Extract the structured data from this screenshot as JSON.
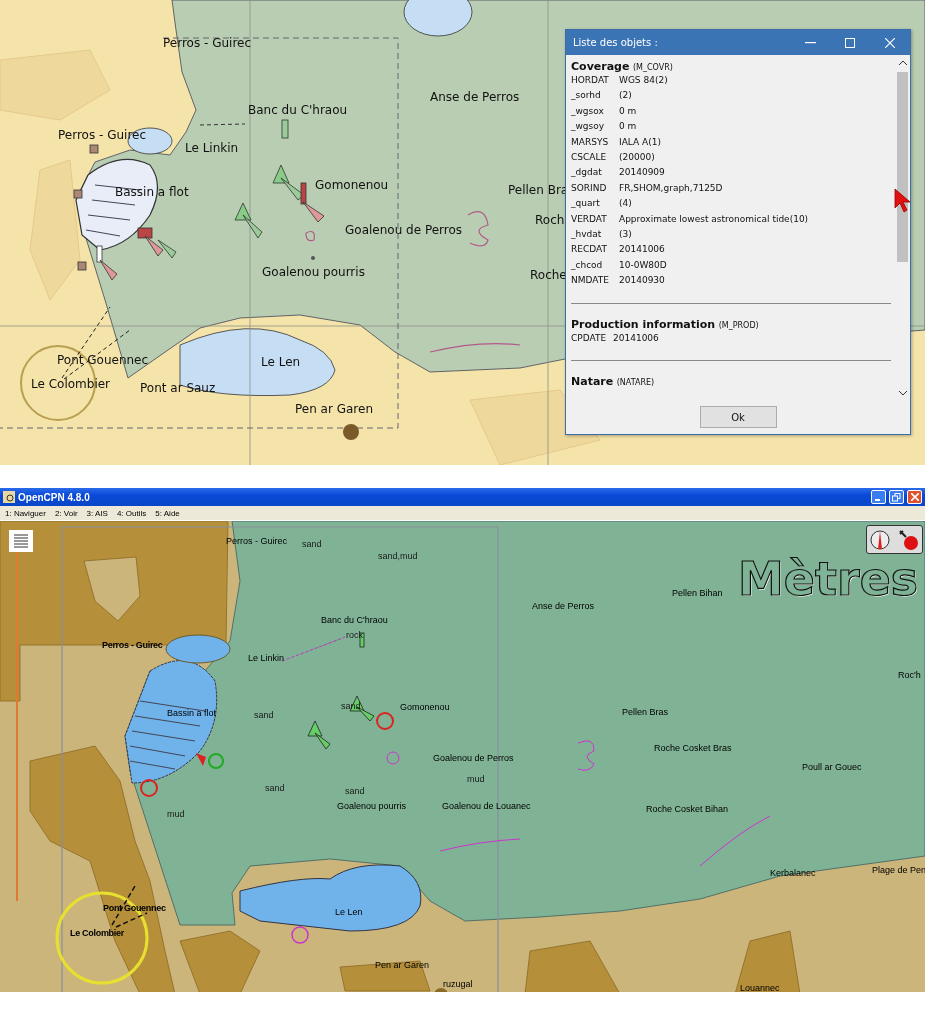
{
  "top_chart": {
    "labels": [
      {
        "text": "Perros - Guirec"
      },
      {
        "text": "Banc du C'hraou"
      },
      {
        "text": "Anse de Perros"
      },
      {
        "text": "Perros - Guirec"
      },
      {
        "text": "Le Linkin"
      },
      {
        "text": "Bassin a flot"
      },
      {
        "text": "Gomonenou"
      },
      {
        "text": "Pellen Bra"
      },
      {
        "text": "Goalenou de Perros"
      },
      {
        "text": "Roch"
      },
      {
        "text": "Goalenou pourris"
      },
      {
        "text": "Roche"
      },
      {
        "text": "Pont Gouennec"
      },
      {
        "text": "Le Colombier"
      },
      {
        "text": "Pont ar Sauz"
      },
      {
        "text": "Le Len"
      },
      {
        "text": "Pen ar Garen"
      }
    ]
  },
  "dialog": {
    "title": "Liste des objets :",
    "sections": [
      {
        "name": "Coverage",
        "code": "(M_COVR)",
        "fields": [
          {
            "key": "HORDAT",
            "value": "WGS 84(2)"
          },
          {
            "key": "_sorhd",
            "value": "(2)"
          },
          {
            "key": "_wgsox",
            "value": "0 m"
          },
          {
            "key": "_wgsoy",
            "value": "0 m"
          },
          {
            "key": "MARSYS",
            "value": "IALA A(1)"
          },
          {
            "key": "CSCALE",
            "value": "(20000)"
          },
          {
            "key": "_dgdat",
            "value": "20140909"
          },
          {
            "key": "SORIND",
            "value": "FR,SHOM,graph,7125D"
          },
          {
            "key": "_quart",
            "value": "(4)"
          },
          {
            "key": "VERDAT",
            "value": "Approximate lowest astronomical tide(10)"
          },
          {
            "key": "_hvdat",
            "value": "(3)"
          },
          {
            "key": "RECDAT",
            "value": "20141006"
          },
          {
            "key": "_chcod",
            "value": "10-0W80D"
          },
          {
            "key": "NMDATE",
            "value": "20140930"
          }
        ]
      },
      {
        "name": "Production information",
        "code": "(M_PROD)",
        "fields": [
          {
            "key": "CPDATE",
            "value": "20141006"
          }
        ]
      },
      {
        "name": "Natare",
        "code": "(NATARE)"
      }
    ],
    "ok_button": "Ok"
  },
  "app": {
    "title": "OpenCPN 4.8.0",
    "menu": [
      "1: Naviguer",
      "2: Voir",
      "3: AIS",
      "4: Outils",
      "5: Aide"
    ],
    "units_overlay": "Mètres",
    "labels": [
      {
        "text": "Perros - Guirec",
        "kind": "place"
      },
      {
        "text": "sand",
        "kind": "seabed"
      },
      {
        "text": "sand,mud",
        "kind": "seabed"
      },
      {
        "text": "Banc du C'hraou",
        "kind": "place"
      },
      {
        "text": "rock",
        "kind": "seabed"
      },
      {
        "text": "Perros - Guirec",
        "kind": "town"
      },
      {
        "text": "Le Linkin",
        "kind": "place"
      },
      {
        "text": "Bassin a flot",
        "kind": "place"
      },
      {
        "text": "sand",
        "kind": "seabed"
      },
      {
        "text": "sand",
        "kind": "seabed"
      },
      {
        "text": "Gomonenou",
        "kind": "place"
      },
      {
        "text": "Goalenou de Perros",
        "kind": "place"
      },
      {
        "text": "mud",
        "kind": "seabed"
      },
      {
        "text": "sand",
        "kind": "seabed"
      },
      {
        "text": "sand",
        "kind": "seabed"
      },
      {
        "text": "Goalenou pourris",
        "kind": "place"
      },
      {
        "text": "Goalenou de Louanec",
        "kind": "place"
      },
      {
        "text": "mud",
        "kind": "seabed"
      },
      {
        "text": "Anse de Perros",
        "kind": "place"
      },
      {
        "text": "Pellen Bihan",
        "kind": "place"
      },
      {
        "text": "Pellen Bras",
        "kind": "place"
      },
      {
        "text": "Roche Cosket Bras",
        "kind": "place"
      },
      {
        "text": "Poull ar Gouec",
        "kind": "place"
      },
      {
        "text": "Roche Cosket Bihan",
        "kind": "place"
      },
      {
        "text": "Roc'h",
        "kind": "place"
      },
      {
        "text": "Plage de Pen",
        "kind": "place"
      },
      {
        "text": "Kerbalanec",
        "kind": "place"
      },
      {
        "text": "Le Len",
        "kind": "place"
      },
      {
        "text": "Pont Gouennec",
        "kind": "town"
      },
      {
        "text": "Le Colombier",
        "kind": "town"
      },
      {
        "text": "Pen ar Garen",
        "kind": "place"
      },
      {
        "text": "ruzugal",
        "kind": "place"
      },
      {
        "text": "Louannec",
        "kind": "place"
      }
    ]
  }
}
